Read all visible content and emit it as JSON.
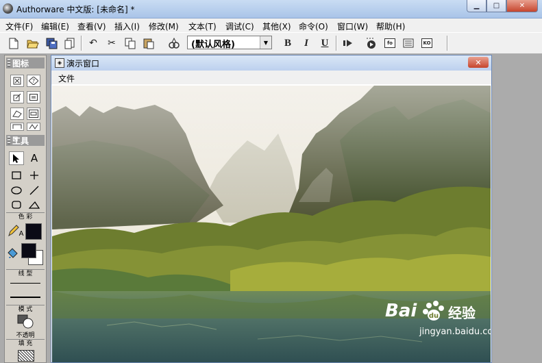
{
  "window": {
    "title": "Authorware 中文版: [未命名] *",
    "min_glyph": "▁",
    "max_glyph": "□",
    "close_glyph": "✕"
  },
  "menubar": {
    "items": [
      {
        "label": "文件(F)"
      },
      {
        "label": "编辑(E)"
      },
      {
        "label": "查看(V)"
      },
      {
        "label": "插入(I)"
      },
      {
        "label": "修改(M)"
      },
      {
        "label": "文本(T)"
      },
      {
        "label": "调试(C)"
      },
      {
        "label": "其他(X)"
      },
      {
        "label": "命令(O)"
      },
      {
        "label": "窗口(W)"
      },
      {
        "label": "帮助(H)"
      }
    ]
  },
  "toolbar": {
    "style_select_value": "(默认风格)",
    "bold": "B",
    "italic": "I",
    "underline": "U",
    "fo_label": "fo",
    "ko_label": "KO"
  },
  "icons_panel": {
    "title": "图标"
  },
  "tools_panel": {
    "title": "工具",
    "text_tool": "A",
    "color_section": "色  彩",
    "line_section": "线  型",
    "mode_section": "模  式",
    "mode_value": "不透明",
    "fill_section": "填  充"
  },
  "presentation": {
    "title": "演示窗口",
    "menu_file": "文件",
    "close_glyph": "✕"
  },
  "watermark": {
    "brand": "Bai",
    "brand_suffix": "经验",
    "url": "jingyan.baidu.com"
  },
  "colors": {
    "title_gradient_top": "#c9dcf3",
    "close_red": "#c6452d",
    "workspace_gray": "#ababab"
  }
}
